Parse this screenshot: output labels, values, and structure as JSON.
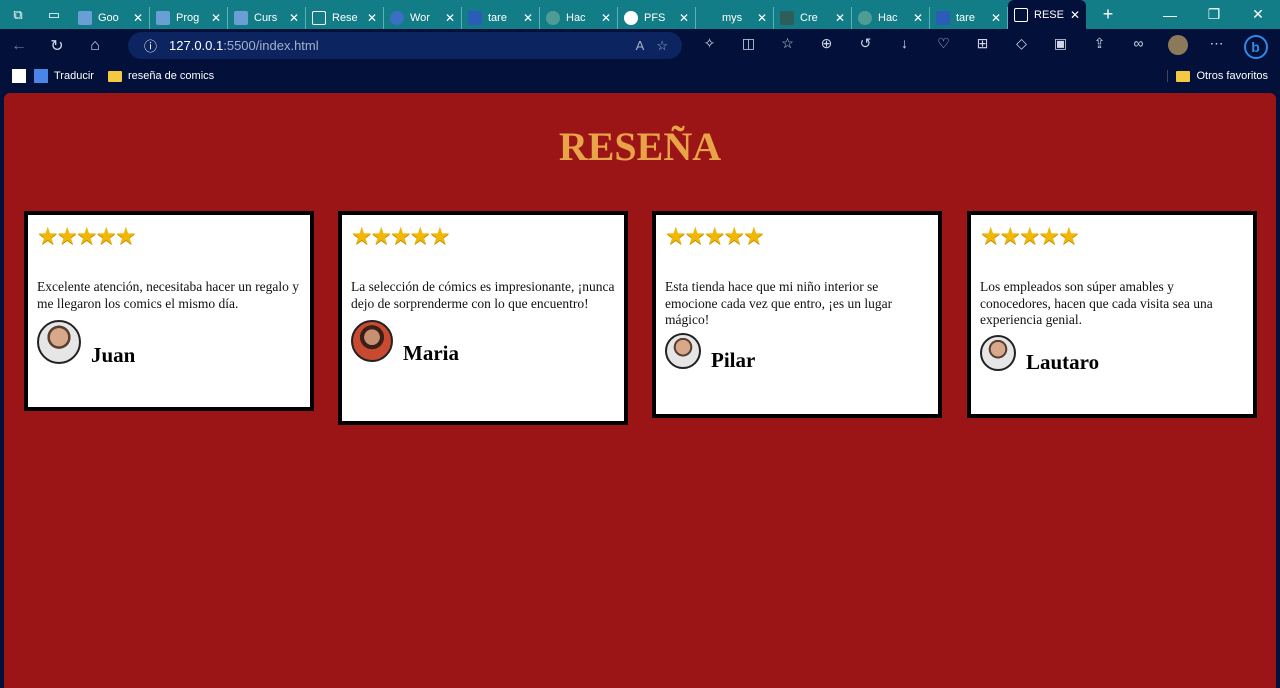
{
  "browser": {
    "tabs": [
      {
        "label": "Goo"
      },
      {
        "label": "Prog"
      },
      {
        "label": "Curs"
      },
      {
        "label": "Rese"
      },
      {
        "label": "Wor"
      },
      {
        "label": "tare"
      },
      {
        "label": "Hac"
      },
      {
        "label": "PFS"
      },
      {
        "label": "mys"
      },
      {
        "label": "Cre"
      },
      {
        "label": "Hac"
      },
      {
        "label": "tare"
      },
      {
        "label": "RESE"
      }
    ],
    "url_host": "127.0.0.1",
    "url_rest": ":5500/index.html",
    "bookmarks": [
      {
        "label": "Traducir"
      },
      {
        "label": "reseña de comics"
      }
    ],
    "other_favorites": "Otros favoritos"
  },
  "page": {
    "title": "RESEÑA",
    "colors": {
      "background": "#9b1516",
      "title": "#e9a449",
      "stars": "#f2b705"
    },
    "reviews": [
      {
        "rating": 5,
        "stars": "★★★★★",
        "text": "Excelente atención, necesitaba hacer un regalo y me llegaron los comics el mismo día.",
        "name": "Juan"
      },
      {
        "rating": 5,
        "stars": "★★★★★",
        "text": "La selección de cómics es impresionante, ¡nunca dejo de sorprenderme con lo que encuentro!",
        "name": "Maria"
      },
      {
        "rating": 5,
        "stars": "★★★★★",
        "text": "Esta tienda hace que mi niño interior se emocione cada vez que entro, ¡es un lugar mágico!",
        "name": "Pilar"
      },
      {
        "rating": 5,
        "stars": "★★★★★",
        "text": "Los empleados son súper amables y conocedores, hacen que cada visita sea una experiencia genial.",
        "name": "Lautaro"
      }
    ]
  }
}
